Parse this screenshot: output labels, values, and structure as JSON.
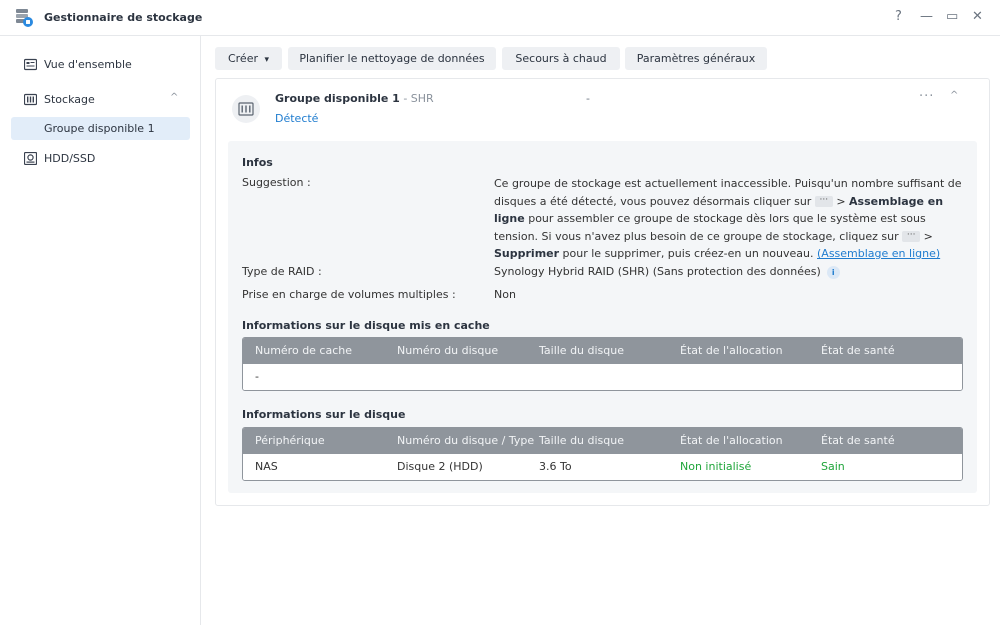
{
  "window": {
    "title": "Gestionnaire de stockage",
    "controls": {
      "help": "?",
      "minimize": "—",
      "maximize": "▭",
      "close": "✕"
    }
  },
  "sidebar": {
    "items": [
      {
        "label": "Vue d'ensemble",
        "icon": "overview-icon"
      },
      {
        "label": "Stockage",
        "icon": "storage-icon",
        "expanded": true,
        "children": [
          {
            "label": "Groupe disponible 1",
            "active": true
          }
        ]
      },
      {
        "label": "HDD/SSD",
        "icon": "hdd-icon"
      }
    ]
  },
  "toolbar": {
    "create": "Créer",
    "create_arrow": "▾",
    "schedule_cleanup": "Planifier le nettoyage de données",
    "hot_spare": "Secours à chaud",
    "global_settings": "Paramètres généraux"
  },
  "pool": {
    "name": "Groupe disponible 1",
    "separator": " - ",
    "type": "SHR",
    "dash": "-",
    "status": "Détecté",
    "more": "···",
    "collapse": "^"
  },
  "info": {
    "title": "Infos",
    "suggestion_label": "Suggestion :",
    "suggestion": {
      "p1": "Ce groupe de stockage est actuellement inaccessible. Puisqu'un nombre suffisant de disques a été détecté, vous pouvez désormais cliquer sur ",
      "dots": "···",
      "p2": " > ",
      "b1": "Assemblage en ligne",
      "p3": " pour assembler ce groupe de stockage dès lors que le système est sous tension. Si vous n'avez plus besoin de ce groupe de stockage, cliquez sur ",
      "p4": " > ",
      "b2": "Supprimer",
      "p5": " pour le supprimer, puis créez-en un nouveau. ",
      "link": "(Assemblage en ligne)"
    },
    "raid_label": "Type de RAID :",
    "raid_value": "Synology Hybrid RAID (SHR) (Sans protection des données)",
    "info_icon": "i",
    "multi_label": "Prise en charge de volumes multiples :",
    "multi_value": "Non"
  },
  "cache_table": {
    "title": "Informations sur le disque mis en cache",
    "headers": [
      "Numéro de cache",
      "Numéro du disque",
      "Taille du disque",
      "État de l'allocation",
      "État de santé"
    ],
    "empty": "-"
  },
  "disk_table": {
    "title": "Informations sur le disque",
    "headers": [
      "Périphérique",
      "Numéro du disque / Type",
      "Taille du disque",
      "État de l'allocation",
      "État de santé"
    ],
    "rows": [
      [
        "NAS",
        "Disque 2 (HDD)",
        "3.6 To",
        "Non initialisé",
        "Sain"
      ]
    ]
  },
  "colors": {
    "accent": "#1f7ccf",
    "healthy": "#1fa53a",
    "table_header": "#8f959c",
    "active_bg": "#e2edf9"
  }
}
